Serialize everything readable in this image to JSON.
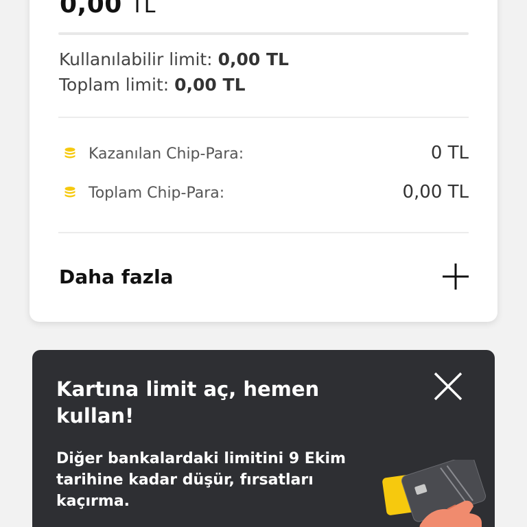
{
  "balance": {
    "amount": "0,00",
    "currency": "TL"
  },
  "limits": {
    "available_label": "Kullanılabilir limit:",
    "available_value": "0,00 TL",
    "total_label": "Toplam limit:",
    "total_value": "0,00 TL"
  },
  "chip_para": {
    "earned_label": "Kazanılan Chip-Para:",
    "earned_value": "0 TL",
    "total_label": "Toplam Chip-Para:",
    "total_value": "0,00 TL",
    "icon": "coin-stack-icon",
    "icon_color": "#f6c90e"
  },
  "more": {
    "label": "Daha fazla",
    "icon": "plus-icon"
  },
  "promo": {
    "title": "Kartına limit aç, hemen kullan!",
    "text": "Diğer bankalardaki limitini 9 Ekim tarihine kadar düşür, fırsatları kaçırma.",
    "close_icon": "close-icon",
    "background": "#2e2f33"
  }
}
